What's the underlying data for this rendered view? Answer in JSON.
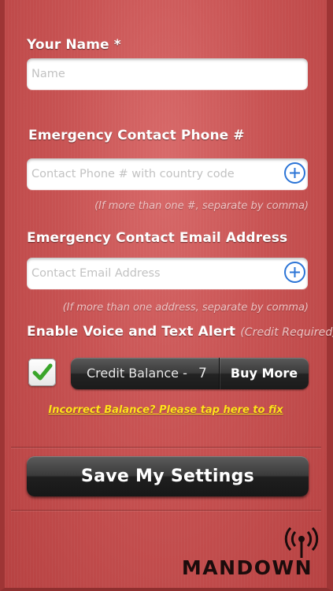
{
  "name_section": {
    "label": "Your Name *",
    "placeholder": "Name",
    "value": ""
  },
  "phone_section": {
    "label": "Emergency Contact Phone #",
    "placeholder": "Contact Phone # with country code",
    "value": "",
    "hint": "(If more than one #, separate by comma)"
  },
  "email_section": {
    "label": "Emergency Contact Email Address",
    "placeholder": "Contact Email Address",
    "value": "",
    "hint": "(If more than one address, separate by comma)"
  },
  "alert_section": {
    "label": "Enable Voice and Text Alert",
    "note": "(Credit Required)",
    "checked": true,
    "credit_label": "Credit Balance -",
    "credit_value": "7",
    "buy_more_label": "Buy More",
    "fix_link": "Incorrect Balance? Please tap here to fix"
  },
  "save_button": {
    "label": "Save My Settings"
  },
  "brand": {
    "name": "MANDOWN",
    "icon": "radio-signal-icon"
  },
  "colors": {
    "background": "#c85353",
    "link": "#ffe21a",
    "plus_icon": "#2b74d6",
    "check": "#3aa52a",
    "button": "#2a2a2a"
  }
}
